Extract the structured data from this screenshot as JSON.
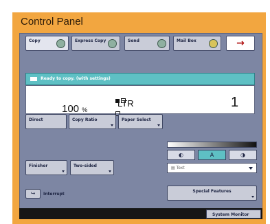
{
  "frame": {
    "title": "Control Panel"
  },
  "tabs": [
    {
      "label": "Copy",
      "icon": "copy-icon"
    },
    {
      "label": "Express Copy",
      "icon": "express-copy-icon"
    },
    {
      "label": "Send",
      "icon": "send-icon"
    },
    {
      "label": "Mail Box",
      "icon": "mailbox-icon"
    },
    {
      "label": "→",
      "icon": "next-arrow-icon"
    }
  ],
  "status": {
    "message": "Ready to copy. (with settings)"
  },
  "copy": {
    "ratio": "100",
    "ratio_unit": "%",
    "paper": "LTR",
    "quantity": "1"
  },
  "buttons": {
    "direct": "Direct",
    "copy_ratio": "Copy Ratio",
    "paper_select": "Paper Select",
    "finisher": "Finisher",
    "two_sided": "Two-sided",
    "special_features": "Special Features",
    "interrupt": "Interrupt",
    "system_monitor": "System Monitor"
  },
  "exposure": {
    "light": "◐",
    "auto": "A",
    "dark": "◑"
  },
  "image_type": {
    "selected": "Text"
  },
  "colors": {
    "frame": "#f2a640",
    "panel": "#7d86a3",
    "status": "#5ec0c4"
  }
}
